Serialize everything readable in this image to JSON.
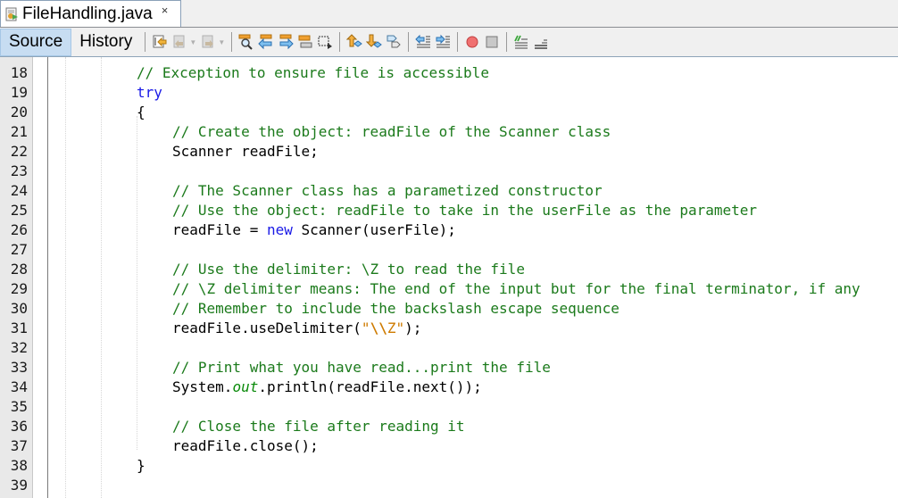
{
  "tab": {
    "title": "FileHandling.java",
    "close_glyph": "×",
    "icon": "java-file-icon"
  },
  "toolbar": {
    "source_label": "Source",
    "history_label": "History",
    "buttons": [
      {
        "name": "last-edit-icon"
      },
      {
        "name": "back-icon"
      },
      {
        "name": "forward-icon"
      },
      {
        "name": "find-selection-icon"
      },
      {
        "name": "find-previous-icon"
      },
      {
        "name": "find-next-icon"
      },
      {
        "name": "toggle-highlight-icon"
      },
      {
        "name": "toggle-rect-selection-icon"
      },
      {
        "name": "previous-bookmark-icon"
      },
      {
        "name": "next-bookmark-icon"
      },
      {
        "name": "toggle-bookmark-icon"
      },
      {
        "name": "shift-left-icon"
      },
      {
        "name": "shift-right-icon"
      },
      {
        "name": "start-macro-recording-icon"
      },
      {
        "name": "stop-macro-recording-icon"
      },
      {
        "name": "comment-icon"
      },
      {
        "name": "uncomment-icon"
      }
    ]
  },
  "editor": {
    "lines": [
      {
        "n": "18",
        "indent": 0,
        "parts": [
          {
            "t": "// Exception to ensure file is accessible",
            "k": "comment"
          }
        ]
      },
      {
        "n": "19",
        "indent": 0,
        "parts": [
          {
            "t": "try",
            "k": "kw"
          }
        ]
      },
      {
        "n": "20",
        "indent": 0,
        "parts": [
          {
            "t": "{",
            "k": "plain"
          }
        ]
      },
      {
        "n": "21",
        "indent": 1,
        "parts": [
          {
            "t": "// Create the object: readFile of the Scanner class",
            "k": "comment"
          }
        ]
      },
      {
        "n": "22",
        "indent": 1,
        "parts": [
          {
            "t": "Scanner readFile;",
            "k": "plain"
          }
        ]
      },
      {
        "n": "23",
        "indent": 1,
        "parts": []
      },
      {
        "n": "24",
        "indent": 1,
        "parts": [
          {
            "t": "// The Scanner class has a parametized constructor",
            "k": "comment"
          }
        ]
      },
      {
        "n": "25",
        "indent": 1,
        "parts": [
          {
            "t": "// Use the object: readFile to take in the userFile as the parameter",
            "k": "comment"
          }
        ]
      },
      {
        "n": "26",
        "indent": 1,
        "parts": [
          {
            "t": "readFile = ",
            "k": "plain"
          },
          {
            "t": "new",
            "k": "kw"
          },
          {
            "t": " Scanner(userFile);",
            "k": "plain"
          }
        ]
      },
      {
        "n": "27",
        "indent": 1,
        "parts": []
      },
      {
        "n": "28",
        "indent": 1,
        "parts": [
          {
            "t": "// Use the delimiter: \\Z to read the file",
            "k": "comment"
          }
        ]
      },
      {
        "n": "29",
        "indent": 1,
        "parts": [
          {
            "t": "// \\Z delimiter means: The end of the input but for the final terminator, if any",
            "k": "comment"
          }
        ]
      },
      {
        "n": "30",
        "indent": 1,
        "parts": [
          {
            "t": "// Remember to include the backslash escape sequence",
            "k": "comment"
          }
        ]
      },
      {
        "n": "31",
        "indent": 1,
        "parts": [
          {
            "t": "readFile.useDelimiter(",
            "k": "plain"
          },
          {
            "t": "\"",
            "k": "str"
          },
          {
            "t": "\\\\",
            "k": "esc"
          },
          {
            "t": "Z\"",
            "k": "str"
          },
          {
            "t": ");",
            "k": "plain"
          }
        ]
      },
      {
        "n": "32",
        "indent": 1,
        "parts": []
      },
      {
        "n": "33",
        "indent": 1,
        "parts": [
          {
            "t": "// Print what you have read...print the file",
            "k": "comment"
          }
        ]
      },
      {
        "n": "34",
        "indent": 1,
        "parts": [
          {
            "t": "System.",
            "k": "plain"
          },
          {
            "t": "out",
            "k": "field"
          },
          {
            "t": ".println(readFile.next());",
            "k": "plain"
          }
        ]
      },
      {
        "n": "35",
        "indent": 1,
        "parts": []
      },
      {
        "n": "36",
        "indent": 1,
        "parts": [
          {
            "t": "// Close the file after reading it",
            "k": "comment"
          }
        ]
      },
      {
        "n": "37",
        "indent": 1,
        "parts": [
          {
            "t": "readFile.close();",
            "k": "plain"
          }
        ]
      },
      {
        "n": "38",
        "indent": 0,
        "parts": [
          {
            "t": "}",
            "k": "plain"
          }
        ]
      },
      {
        "n": "39",
        "indent": 0,
        "parts": []
      }
    ]
  }
}
